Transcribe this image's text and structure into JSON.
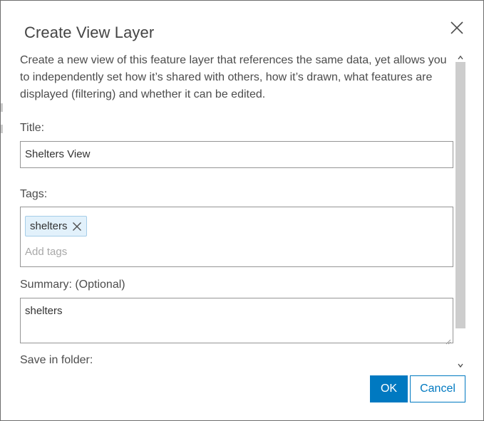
{
  "dialog": {
    "title": "Create View Layer",
    "description": "Create a new view of this feature layer that references the same data, yet allows you to independently set how it’s shared with others, how it’s drawn, what features are displayed (filtering) and whether it can be edited."
  },
  "form": {
    "title_label": "Title:",
    "title_value": "Shelters View",
    "tags_label": "Tags:",
    "tags": [
      "shelters"
    ],
    "tags_placeholder": "Add tags",
    "summary_label": "Summary: (Optional)",
    "summary_value": "shelters",
    "folder_label": "Save in folder:"
  },
  "buttons": {
    "ok": "OK",
    "cancel": "Cancel"
  },
  "colors": {
    "accent": "#0079c1",
    "tag_background": "#e2f1fb"
  },
  "icons": {
    "close": "close-icon",
    "tag_remove": "tag-remove-icon",
    "scroll_up": "chevron-up-icon",
    "scroll_down": "chevron-down-icon"
  }
}
